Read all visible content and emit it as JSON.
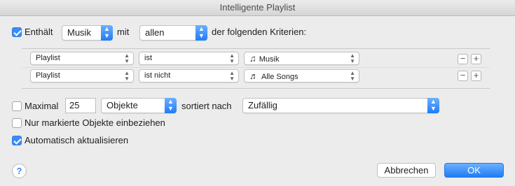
{
  "window": {
    "title": "Intelligente Playlist"
  },
  "match": {
    "checkbox_label": "Enthält",
    "media_value": "Musik",
    "mit_label": "mit",
    "scope_value": "allen",
    "suffix_label": "der folgenden Kriterien:"
  },
  "rules": [
    {
      "field": "Playlist",
      "operator": "ist",
      "value": "Musik",
      "value_icon": "music-note-icon"
    },
    {
      "field": "Playlist",
      "operator": "ist nicht",
      "value": "Alle Songs",
      "value_icon": "song-list-icon"
    }
  ],
  "limit": {
    "checkbox_label": "Maximal",
    "count": "25",
    "unit_value": "Objekte",
    "sort_label": "sortiert nach",
    "sort_value": "Zufällig"
  },
  "options": {
    "checked_only_label": "Nur markierte Objekte einbeziehen",
    "live_update_label": "Automatisch aktualisieren"
  },
  "buttons": {
    "cancel": "Abbrechen",
    "ok": "OK",
    "help": "?"
  },
  "colors": {
    "accent": "#3b8cf7"
  }
}
